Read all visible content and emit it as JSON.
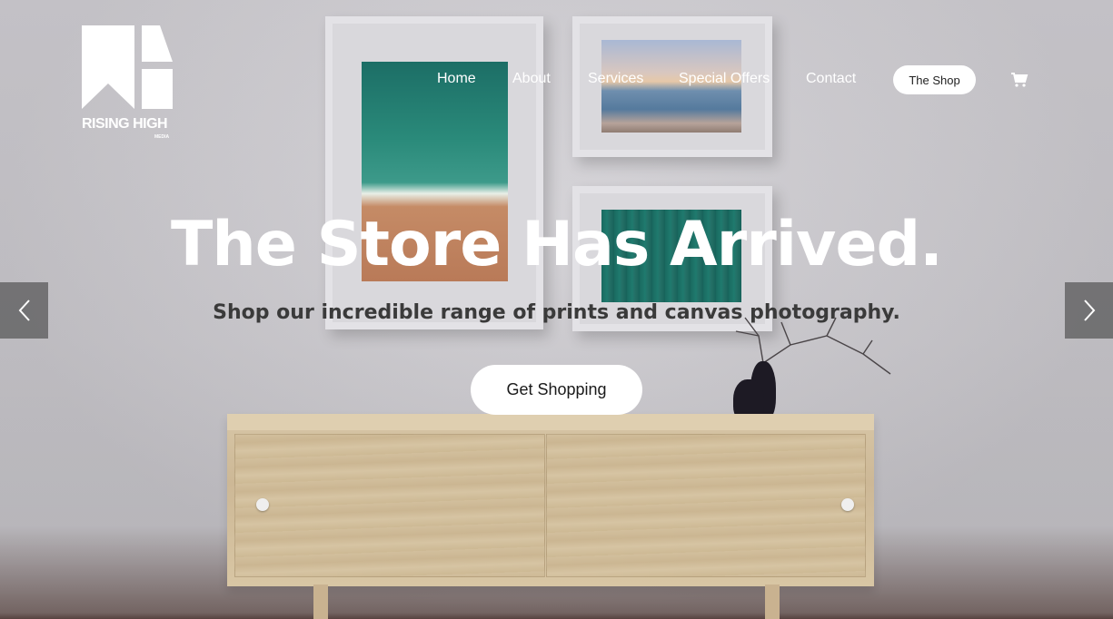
{
  "brand": {
    "name": "RISING HIGH",
    "sub": "MEDIA"
  },
  "nav": {
    "items": [
      {
        "label": "Home"
      },
      {
        "label": "About"
      },
      {
        "label": "Services"
      },
      {
        "label": "Special Offers"
      },
      {
        "label": "Contact"
      }
    ],
    "shop_label": "The Shop",
    "cart_icon": "shopping-cart-icon"
  },
  "hero": {
    "headline": "The Store Has Arrived.",
    "subline": "Shop our incredible range of prints and canvas photography.",
    "cta_label": "Get Shopping"
  },
  "carousel": {
    "prev_icon": "chevron-left-icon",
    "next_icon": "chevron-right-icon"
  },
  "colors": {
    "accent": "#ffffff",
    "overlay": "#5a5a5a",
    "text_dark": "#3a3a3a"
  }
}
